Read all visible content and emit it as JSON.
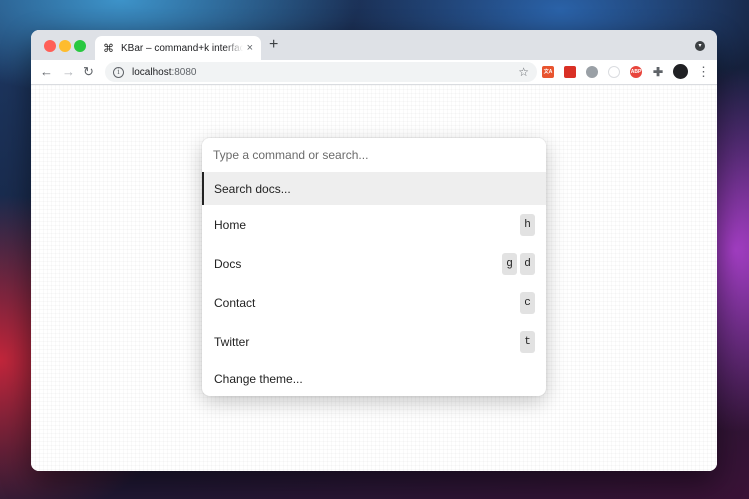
{
  "browser": {
    "tab": {
      "favicon": "⌘",
      "title": "KBar – command+k interface for your site",
      "close": "×"
    },
    "new_tab": "+",
    "nav": {
      "back": "←",
      "forward": "→",
      "reload": "↻"
    },
    "address": {
      "host": "localhost",
      "port": ":8080"
    },
    "bookmark": "☆",
    "extensions": [
      {
        "icon": "translate-extension-icon",
        "color": "#e8542f",
        "label": "文A"
      },
      {
        "icon": "red-extension-icon",
        "color": "#d93025",
        "label": ""
      },
      {
        "icon": "grey-extension-icon",
        "color": "#9aa0a6",
        "label": ""
      },
      {
        "icon": "white-extension-icon",
        "color": "#dadce0",
        "label": ""
      },
      {
        "icon": "adblock-extension-icon",
        "color": "#e8453c",
        "label": "ABP"
      },
      {
        "icon": "puzzle-icon",
        "color": "#5f6368",
        "label": ""
      },
      {
        "icon": "profile-avatar-icon",
        "color": "#202124",
        "label": ""
      }
    ],
    "menu": "⋮"
  },
  "kbar": {
    "search_placeholder": "Type a command or search...",
    "items": [
      {
        "label": "Search docs...",
        "shortcut": []
      },
      {
        "label": "Home",
        "shortcut": [
          "h"
        ]
      },
      {
        "label": "Docs",
        "shortcut": [
          "g",
          "d"
        ]
      },
      {
        "label": "Contact",
        "shortcut": [
          "c"
        ]
      },
      {
        "label": "Twitter",
        "shortcut": [
          "t"
        ]
      },
      {
        "label": "Change theme...",
        "shortcut": []
      }
    ]
  }
}
